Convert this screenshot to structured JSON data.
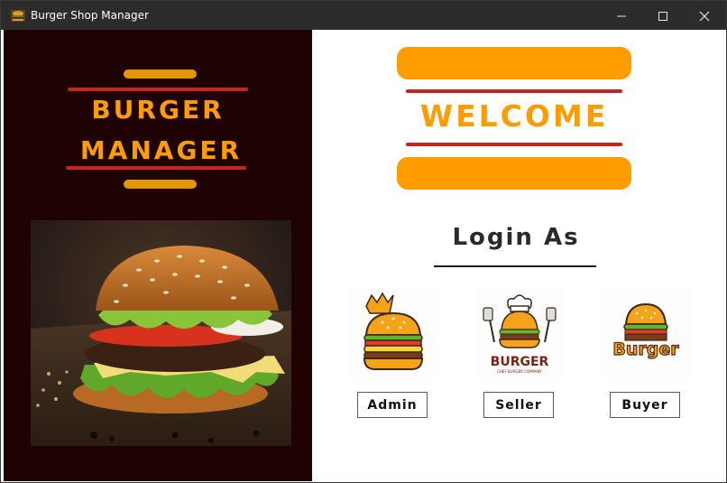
{
  "window": {
    "title": "Burger Shop Manager"
  },
  "titlebar_controls": [
    "minimize-icon",
    "maximize-icon",
    "close-icon"
  ],
  "brand": {
    "line1": "BURGER",
    "line2": "MANAGER"
  },
  "welcome": {
    "text": "WELCOME"
  },
  "login": {
    "title": "Login As",
    "roles": [
      {
        "label": "Admin",
        "logo_text": ""
      },
      {
        "label": "Seller",
        "logo_text": "BURGER",
        "logo_subtext": "CHEF BURGER COMPANY"
      },
      {
        "label": "Buyer",
        "logo_text": "Burger"
      }
    ]
  },
  "colors": {
    "left_bg": "#1f0302",
    "accent_orange": "#ff9d00",
    "accent_red": "#c4251f",
    "right_bg": "#ffffff"
  }
}
